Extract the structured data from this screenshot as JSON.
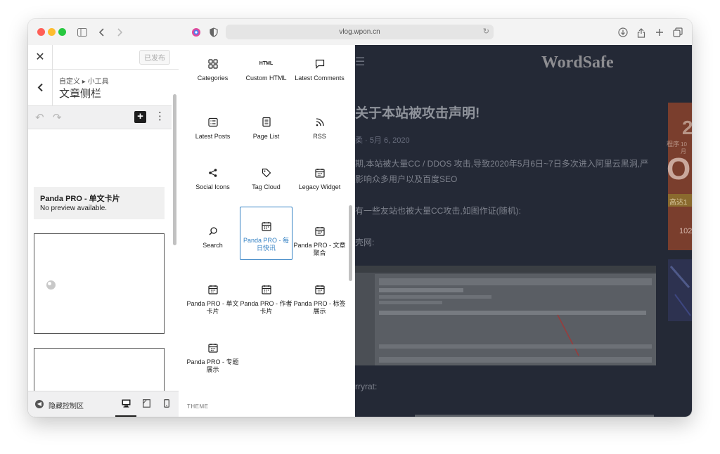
{
  "browser": {
    "url": "vlog.wpon.cn",
    "traffic_lights": [
      "#ff5f57",
      "#febc2e",
      "#28c840"
    ]
  },
  "customizer": {
    "published_label": "已发布",
    "breadcrumb": "自定义 ▸ 小工具",
    "section_title": "文章侧栏",
    "block_card": {
      "title": "Panda PRO - 单文卡片",
      "subtitle": "No preview available."
    },
    "footer_label": "隐藏控制区"
  },
  "inserter": {
    "blocks": [
      {
        "label": "Categories",
        "icon": "categories-icon"
      },
      {
        "label": "Custom HTML",
        "icon": "html-icon",
        "icon_text": "HTML"
      },
      {
        "label": "Latest Comments",
        "icon": "comment-icon"
      },
      {
        "label": "Latest Posts",
        "icon": "list-icon"
      },
      {
        "label": "Page List",
        "icon": "page-list-icon"
      },
      {
        "label": "RSS",
        "icon": "rss-icon"
      },
      {
        "label": "Social Icons",
        "icon": "share-icon"
      },
      {
        "label": "Tag Cloud",
        "icon": "tag-icon"
      },
      {
        "label": "Legacy Widget",
        "icon": "calendar-icon"
      },
      {
        "label": "Search",
        "icon": "search-icon"
      },
      {
        "label": "Panda PRO - 每日快讯",
        "icon": "calendar-icon",
        "selected": true
      },
      {
        "label": "Panda PRO - 文章聚合",
        "icon": "calendar-icon"
      },
      {
        "label": "Panda PRO - 单文卡片",
        "icon": "calendar-icon"
      },
      {
        "label": "Panda PRO - 作者卡片",
        "icon": "calendar-icon"
      },
      {
        "label": "Panda PRO - 标签展示",
        "icon": "calendar-icon"
      },
      {
        "label": "Panda PRO - 专题展示",
        "icon": "calendar-icon"
      }
    ],
    "section_label": "THEME"
  },
  "site": {
    "title": "WordSafe",
    "post_title": "关于本站被攻击声明!",
    "post_meta": "柔 · 5月 6, 2020",
    "paragraph_1": "期,本站被大量CC / DDOS 攻击,导致2020年5月6日~7日多次进入阿里云黑洞,严",
    "paragraph_1b": "影响众多用户以及百度SEO",
    "paragraph_2": "有一些友站也被大量CC攻击,如图作证(随机):",
    "paragraph_3": "壳网:",
    "paragraph_4": "rryrat:",
    "ad_numbers": [
      "2",
      "O",
      "102"
    ],
    "ad_text": "高达1",
    "ad_text2": "程序",
    "ad_text3": "10月"
  }
}
